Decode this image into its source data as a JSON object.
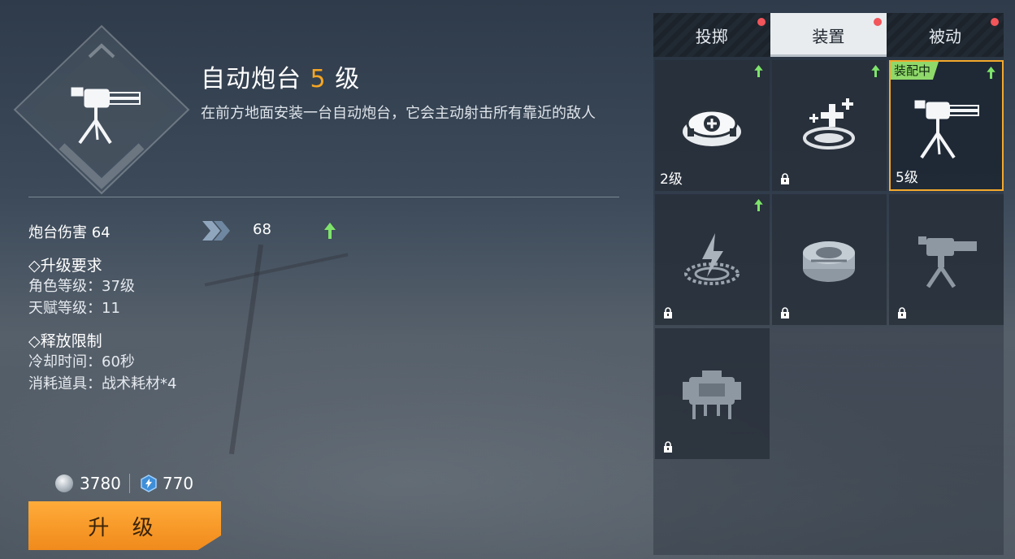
{
  "skill": {
    "name": "自动炮台",
    "level_num": "5",
    "level_suffix": "级",
    "description": "在前方地面安装一台自动炮台，它会主动射击所有靠近的敌人"
  },
  "stat": {
    "label": "炮台伤害 64",
    "next_value": "68"
  },
  "requirements": {
    "title": "◇升级要求",
    "lines": [
      "角色等级：37级",
      "天赋等级：11"
    ]
  },
  "limits": {
    "title": "◇释放限制",
    "lines": [
      "冷却时间：60秒",
      "消耗道具：战术耗材*4"
    ]
  },
  "cost": {
    "silver": "3780",
    "gem": "770"
  },
  "upgrade_button": "升 级",
  "tabs": [
    {
      "label": "投掷",
      "dot": true,
      "active": false
    },
    {
      "label": "装置",
      "dot": true,
      "active": true
    },
    {
      "label": "被动",
      "dot": true,
      "active": false
    }
  ],
  "equip_tag": "装配中",
  "grid": [
    {
      "icon": "mine-device-icon",
      "level": "2级",
      "locked": false,
      "upgradable": true,
      "equipped": false
    },
    {
      "icon": "heal-station-icon",
      "level": "",
      "locked": true,
      "upgradable": true,
      "equipped": false
    },
    {
      "icon": "auto-turret-icon",
      "level": "5级",
      "locked": false,
      "upgradable": true,
      "equipped": true
    },
    {
      "icon": "shock-trap-icon",
      "level": "",
      "locked": true,
      "upgradable": true,
      "equipped": false
    },
    {
      "icon": "landmine-icon",
      "level": "",
      "locked": true,
      "upgradable": false,
      "equipped": false
    },
    {
      "icon": "heavy-turret-icon",
      "level": "",
      "locked": true,
      "upgradable": false,
      "equipped": false
    },
    {
      "icon": "drone-icon",
      "level": "",
      "locked": true,
      "upgradable": false,
      "equipped": false
    }
  ],
  "colors": {
    "accent": "#f6a623",
    "upgrade_arrow": "#7ee36a",
    "tab_dot": "#f2555a",
    "equip_tag": "#8fd86a"
  }
}
